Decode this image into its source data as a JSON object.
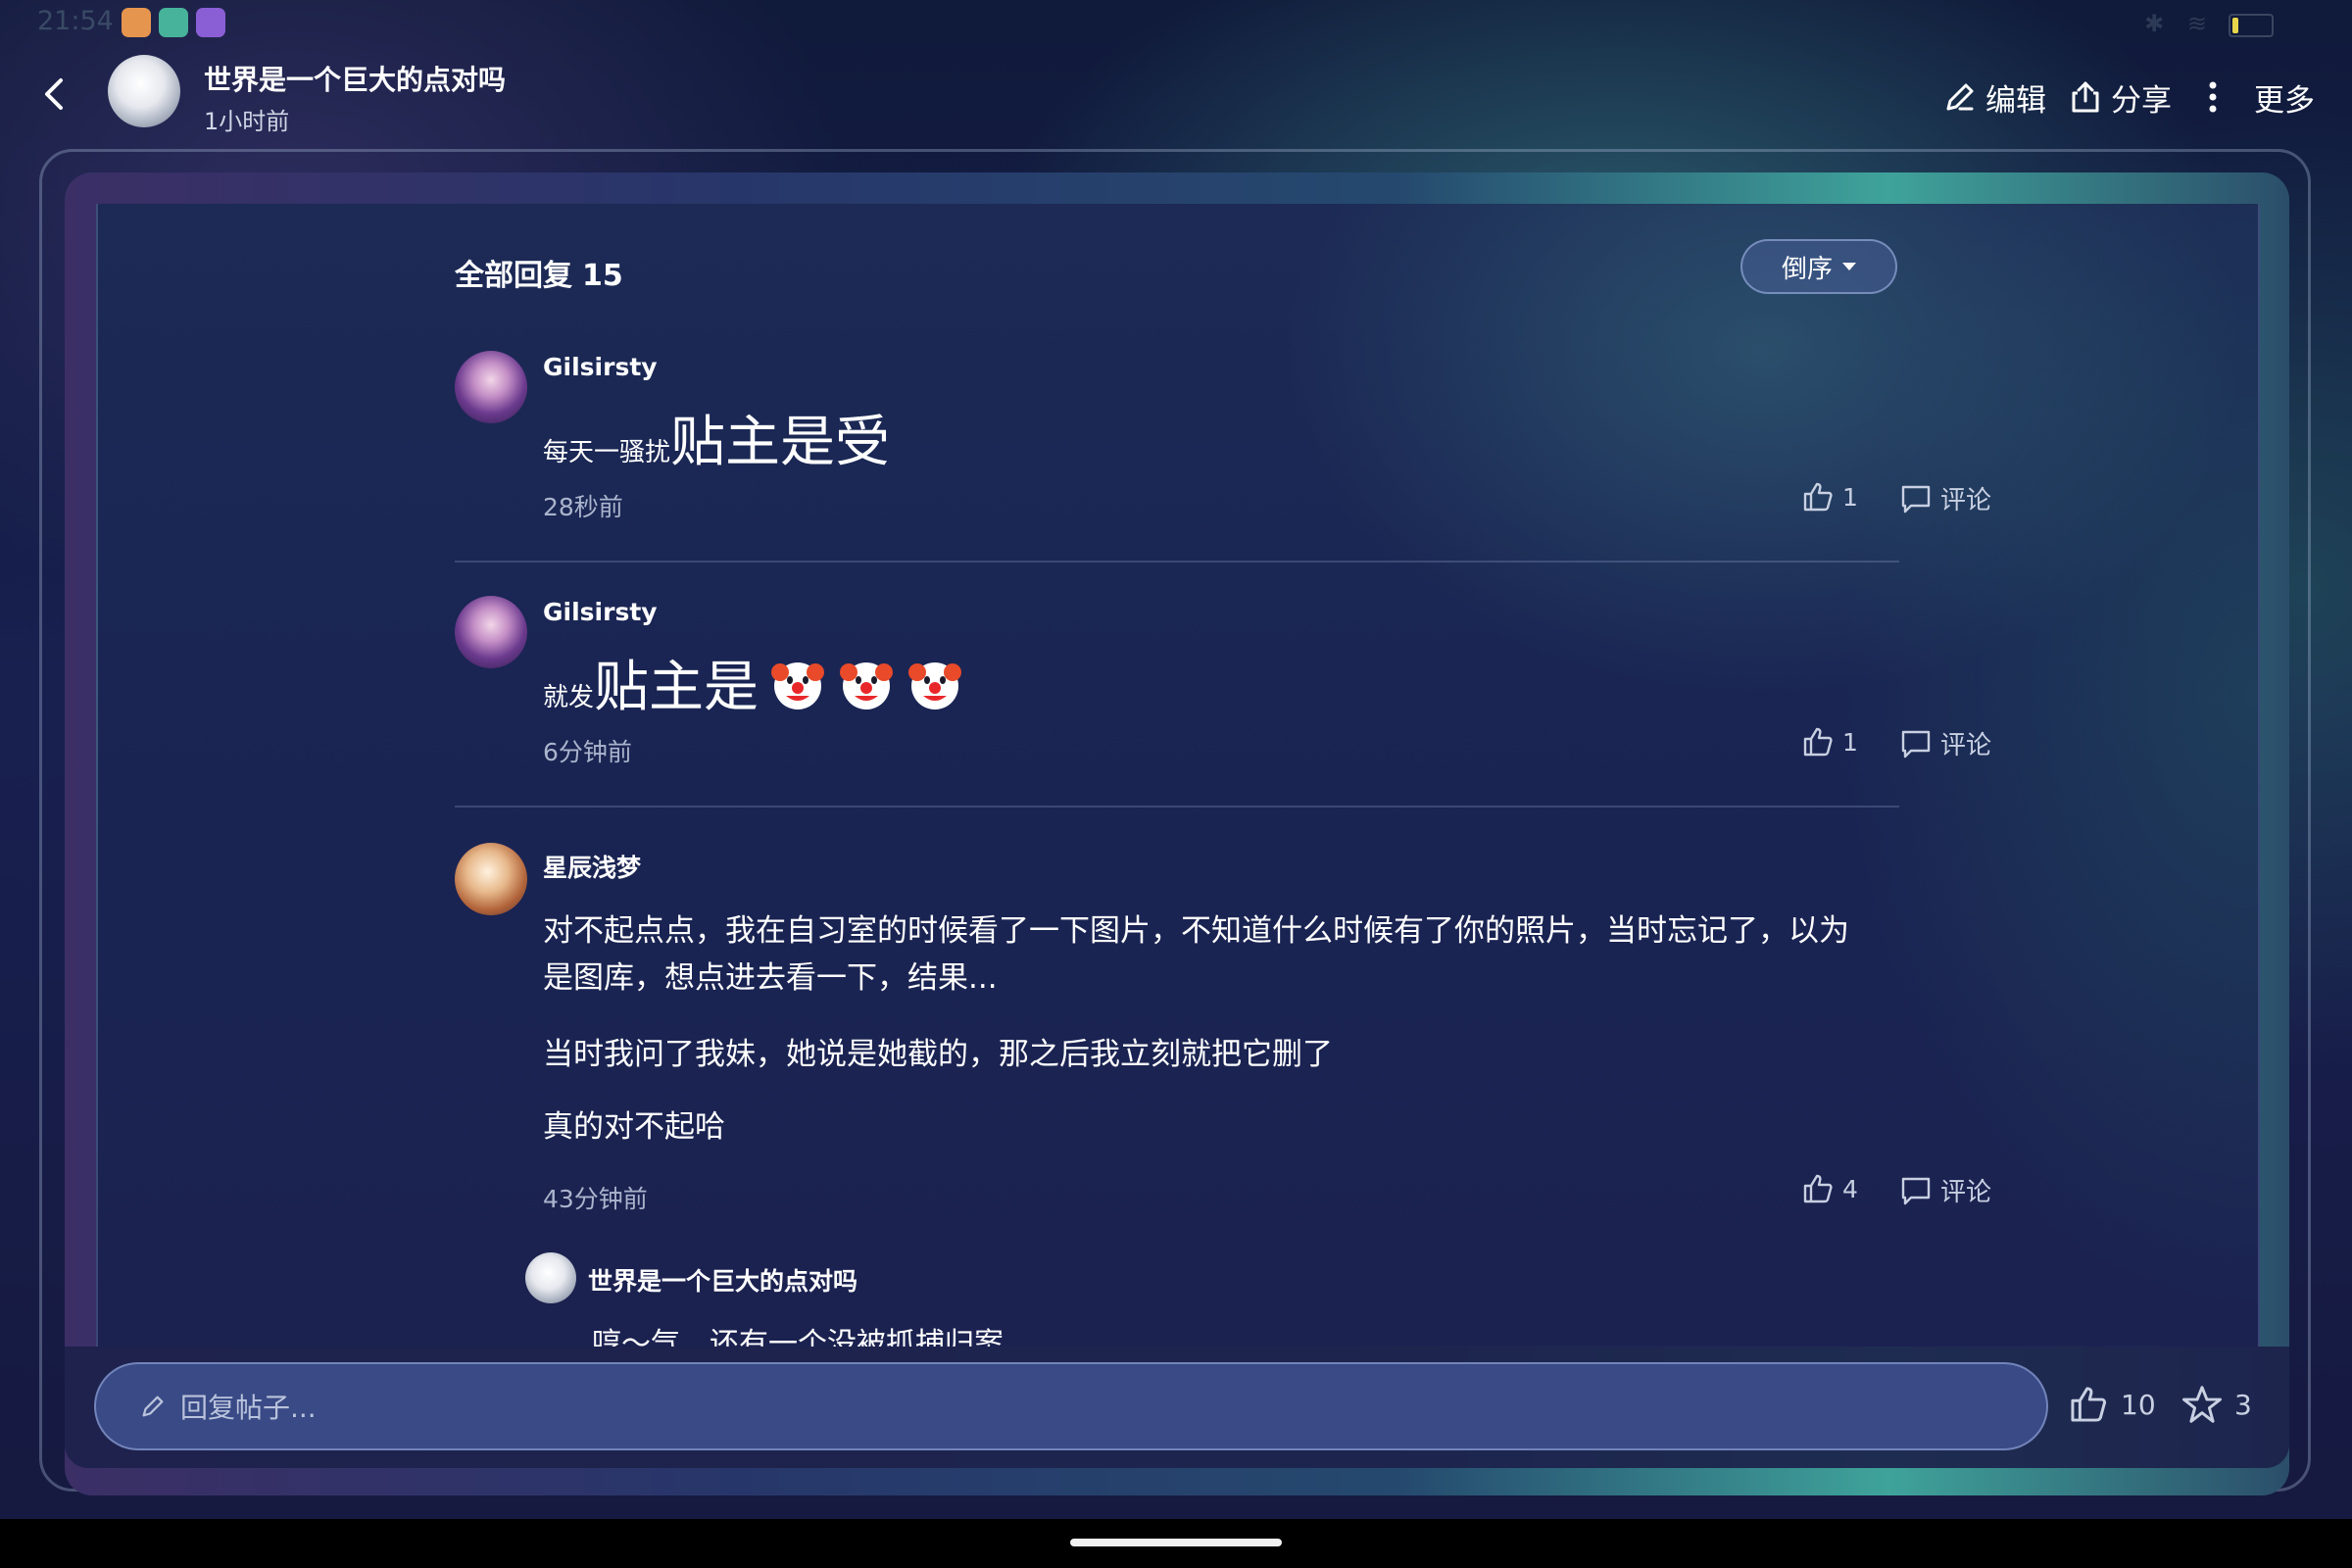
{
  "status_bar": {
    "time": "21:54",
    "apps": [
      {
        "icon": "app-avatar-orange-icon",
        "color": "#e6954f"
      },
      {
        "icon": "app-robot-green-icon",
        "color": "#47b39a"
      },
      {
        "icon": "app-camera-purple-icon",
        "color": "#8a5fd6"
      }
    ],
    "battery_level": 0.15,
    "battery_color": "#e8d64a"
  },
  "header": {
    "title": "世界是一个巨大的点对吗",
    "subtitle": "1小时前",
    "actions": [
      {
        "label": "编辑",
        "icon": "pencil-icon"
      },
      {
        "label": "分享",
        "icon": "share-icon"
      },
      {
        "label": "更多",
        "icon": "more-vertical-icon"
      }
    ]
  },
  "replies": {
    "heading": "全部回复",
    "count": "15",
    "sort_label": "倒序"
  },
  "comments": [
    {
      "user": "Gilsirsty",
      "small_text": "每天一骚扰",
      "big_text": "贴主是受",
      "time": "28秒前",
      "likes": "1",
      "reply_label": "评论"
    },
    {
      "user": "Gilsirsty",
      "small_text": "就发",
      "big_text": "贴主是",
      "emoji": [
        "clown-face-icon",
        "clown-face-icon",
        "clown-face-icon"
      ],
      "time": "6分钟前",
      "likes": "1",
      "reply_label": "评论"
    },
    {
      "user": "星辰浅梦",
      "paragraphs": [
        "对不起点点，我在自习室的时候看了一下图片，不知道什么时候有了你的照片，当时忘记了，以为是图库，想点进去看一下，结果...",
        "当时我问了我妹，她说是她截的，那之后我立刻就把它删了",
        "真的对不起哈"
      ],
      "time": "43分钟前",
      "likes": "4",
      "reply_label": "评论"
    }
  ],
  "sub_reply": {
    "user": "世界是一个巨大的点对吗",
    "text": "哼～气　还有一个没被抓捕归案"
  },
  "bottom_bar": {
    "placeholder": "回复帖子...",
    "likes": "10",
    "stars": "3"
  }
}
